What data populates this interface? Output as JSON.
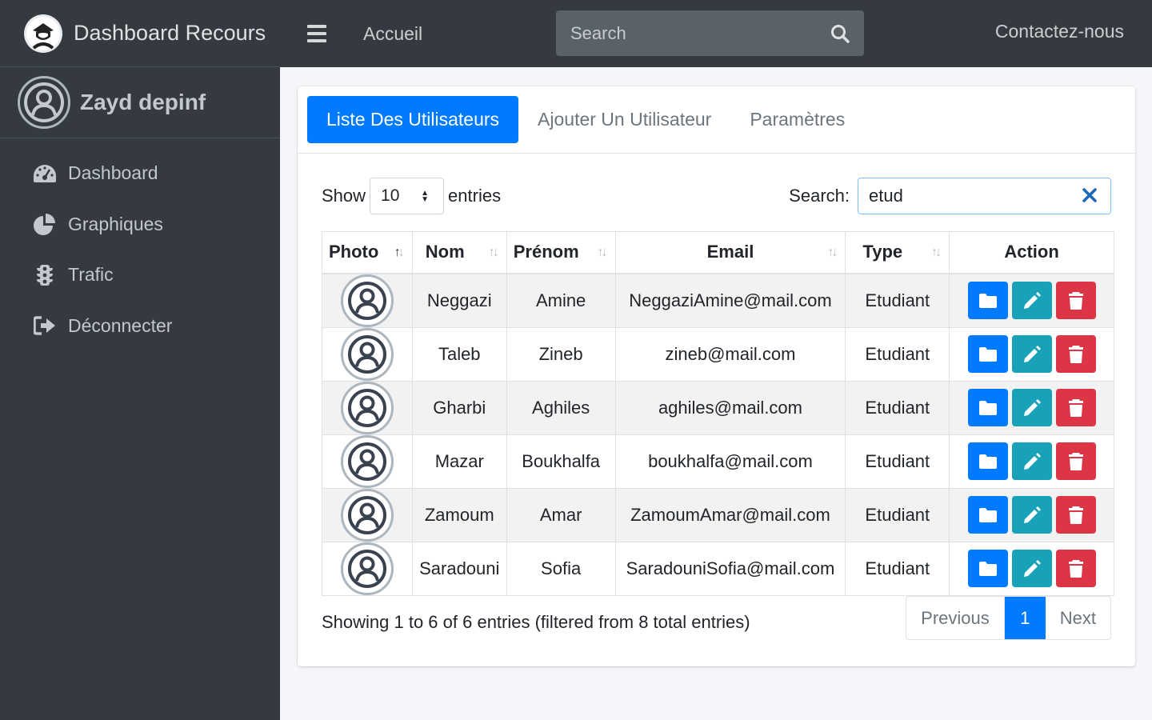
{
  "brand": {
    "title": "Dashboard Recours"
  },
  "user": {
    "name": "Zayd depinf"
  },
  "sidebar": {
    "items": [
      {
        "label": "Dashboard",
        "icon": "tachometer-icon"
      },
      {
        "label": "Graphiques",
        "icon": "pie-chart-icon"
      },
      {
        "label": "Trafic",
        "icon": "traffic-light-icon"
      },
      {
        "label": "Déconnecter",
        "icon": "sign-out-icon"
      }
    ]
  },
  "topbar": {
    "home_label": "Accueil",
    "search_placeholder": "Search",
    "contact_label": "Contactez-nous"
  },
  "tabs": [
    {
      "label": "Liste Des Utilisateurs",
      "active": true
    },
    {
      "label": "Ajouter Un Utilisateur",
      "active": false
    },
    {
      "label": "Paramètres",
      "active": false
    }
  ],
  "table_controls": {
    "show_label": "Show",
    "entries_label": "entries",
    "page_size": "10",
    "search_label": "Search:",
    "search_value": "etud"
  },
  "table": {
    "headers": [
      "Photo",
      "Nom",
      "Prénom",
      "Email",
      "Type",
      "Action"
    ],
    "rows": [
      {
        "nom": "Neggazi",
        "prenom": "Amine",
        "email": "NeggaziAmine@mail.com",
        "type": "Etudiant"
      },
      {
        "nom": "Taleb",
        "prenom": "Zineb",
        "email": "zineb@mail.com",
        "type": "Etudiant"
      },
      {
        "nom": "Gharbi",
        "prenom": "Aghiles",
        "email": "aghiles@mail.com",
        "type": "Etudiant"
      },
      {
        "nom": "Mazar",
        "prenom": "Boukhalfa",
        "email": "boukhalfa@mail.com",
        "type": "Etudiant"
      },
      {
        "nom": "Zamoum",
        "prenom": "Amar",
        "email": "ZamoumAmar@mail.com",
        "type": "Etudiant"
      },
      {
        "nom": "Saradouni",
        "prenom": "Sofia",
        "email": "SaradouniSofia@mail.com",
        "type": "Etudiant"
      }
    ]
  },
  "footer": {
    "info": "Showing 1 to 6 of 6 entries (filtered from 8 total entries)",
    "previous": "Previous",
    "current_page": "1",
    "next": "Next"
  },
  "colors": {
    "sidebar_bg": "#343a40",
    "primary": "#007bff",
    "info": "#17a2b8",
    "danger": "#dc3545"
  }
}
